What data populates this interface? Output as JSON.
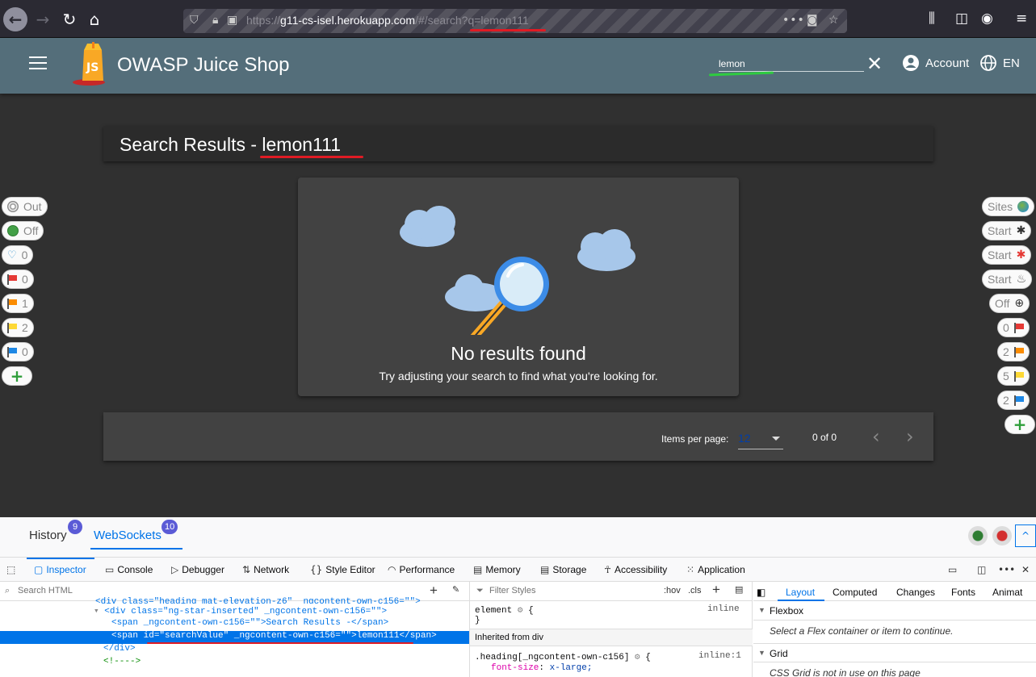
{
  "browser": {
    "url_scheme": "https://",
    "url_host": "g11-cs-isel.herokuapp.com",
    "url_path": "/#/search?q=lemon111",
    "more_icon": "•••"
  },
  "app": {
    "title": "OWASP Juice Shop",
    "search_value": "lemon",
    "account_label": "Account",
    "language_label": "EN"
  },
  "results": {
    "heading_prefix": "Search Results - ",
    "heading_query": "lemon111",
    "no_results_title": "No results found",
    "no_results_subtitle": "Try adjusting your search to find what you're looking for."
  },
  "paginator": {
    "items_per_page_label": "Items per page:",
    "items_per_page_value": "12",
    "range_label": "0 of 0"
  },
  "left_pills": [
    {
      "label": "Out",
      "icon": "target-icon"
    },
    {
      "label": "Off",
      "icon": "green-dot-icon"
    },
    {
      "label": "0",
      "icon": "lightbulb-icon"
    },
    {
      "label": "0",
      "icon": "red-flag-icon"
    },
    {
      "label": "1",
      "icon": "orange-flag-icon"
    },
    {
      "label": "2",
      "icon": "yellow-flag-icon"
    },
    {
      "label": "0",
      "icon": "blue-flag-icon"
    }
  ],
  "right_pills": [
    {
      "label": "Sites",
      "icon": "globe-icon"
    },
    {
      "label": "Start",
      "icon": "spider-icon"
    },
    {
      "label": "Start",
      "icon": "red-spider-icon"
    },
    {
      "label": "Start",
      "icon": "flame-icon"
    },
    {
      "label": "Off",
      "icon": "crosshair-icon"
    },
    {
      "label": "0",
      "icon": "red-flag-icon"
    },
    {
      "label": "2",
      "icon": "orange-flag-icon"
    },
    {
      "label": "5",
      "icon": "yellow-flag-icon"
    },
    {
      "label": "2",
      "icon": "blue-flag-icon"
    }
  ],
  "devtools": {
    "top_tabs": [
      {
        "label": "History",
        "badge": "9"
      },
      {
        "label": "WebSockets",
        "badge": "10"
      }
    ],
    "tools": [
      "Inspector",
      "Console",
      "Debugger",
      "Network",
      "Style Editor",
      "Performance",
      "Memory",
      "Storage",
      "Accessibility",
      "Application"
    ],
    "search_html_placeholder": "Search HTML",
    "filter_styles_placeholder": "Filter Styles",
    "hov": ":hov",
    "cls": ".cls",
    "markup": {
      "line0": "<div class=\"heading mat-elevation-z6\" _ngcontent-own-c156=\"\">",
      "line1": "<div class=\"ng-star-inserted\" _ngcontent-own-c156=\"\">",
      "line2": "<span _ngcontent-own-c156=\"\">Search Results -</span>",
      "line3_open": "<span",
      "line3_attr1": " id=",
      "line3_val1": "\"searchValue\"",
      "line3_attr2": " _ngcontent-own-c156=",
      "line3_val2": "\"\"",
      "line3_rest": ">lemon111</span>",
      "line4": "</div>",
      "line5": "<!---->"
    },
    "rules": {
      "element_line": "element",
      "element_brace": "{",
      "element_inline": "inline",
      "element_close": "}",
      "inherited": "Inherited from div",
      "heading_selector": ".heading[_ngcontent-own-c156]",
      "heading_brace": "{",
      "heading_source": "inline:1",
      "prop_name": "font-size",
      "prop_value": "x-large;"
    },
    "layout_tabs": [
      "Layout",
      "Computed",
      "Changes",
      "Fonts",
      "Animat"
    ],
    "flexbox_title": "Flexbox",
    "flexbox_hint": "Select a Flex container or item to continue.",
    "grid_title": "Grid",
    "grid_hint": "CSS Grid is not in use on this page"
  },
  "colors": {
    "app_toolbar": "#546e7a",
    "accent_blue": "#0074e8",
    "annotation_red": "#e01b24",
    "annotation_green": "#2ecc40"
  }
}
